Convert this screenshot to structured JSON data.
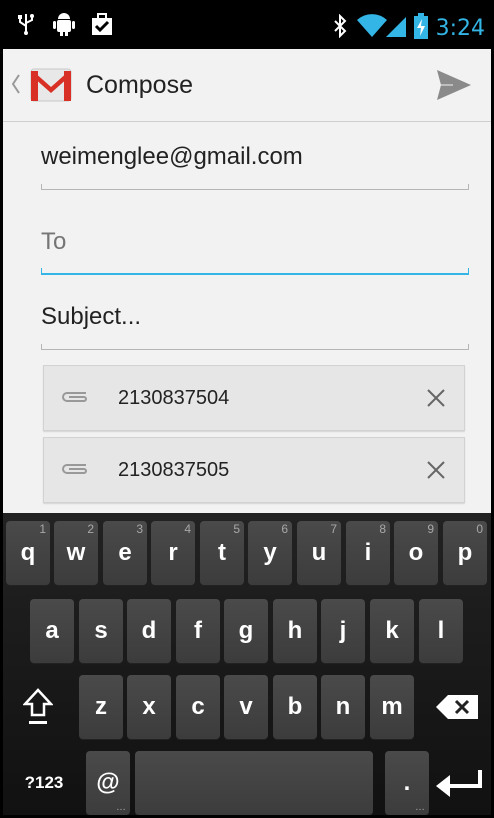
{
  "status_bar": {
    "time": "3:24",
    "icons": [
      "usb-icon",
      "android-debug-icon",
      "download-done-icon",
      "bluetooth-icon",
      "wifi-icon",
      "signal-icon",
      "battery-charging-icon"
    ]
  },
  "action_bar": {
    "title": "Compose",
    "icons": [
      "up-caret-icon",
      "gmail-icon",
      "send-icon"
    ]
  },
  "compose": {
    "from": "weimenglee@gmail.com",
    "to_placeholder": "To",
    "subject": "Subject..."
  },
  "attachments": [
    {
      "name": "2130837504"
    },
    {
      "name": "2130837505"
    }
  ],
  "keyboard": {
    "row1": [
      {
        "label": "q",
        "hint": "1"
      },
      {
        "label": "w",
        "hint": "2"
      },
      {
        "label": "e",
        "hint": "3"
      },
      {
        "label": "r",
        "hint": "4"
      },
      {
        "label": "t",
        "hint": "5"
      },
      {
        "label": "y",
        "hint": "6"
      },
      {
        "label": "u",
        "hint": "7"
      },
      {
        "label": "i",
        "hint": "8"
      },
      {
        "label": "o",
        "hint": "9"
      },
      {
        "label": "p",
        "hint": "0"
      }
    ],
    "row2": [
      "a",
      "s",
      "d",
      "f",
      "g",
      "h",
      "j",
      "k",
      "l"
    ],
    "row3": [
      "z",
      "x",
      "c",
      "v",
      "b",
      "n",
      "m"
    ],
    "symbols_label": "?123",
    "at_label": "@",
    "period_label": ".",
    "key_icons": [
      "shift-icon",
      "backspace-icon",
      "enter-icon"
    ]
  },
  "colors": {
    "accent": "#33b5e5",
    "background": "#f2f2f2",
    "keyboard": "#1a1a1a",
    "key": "#444444"
  }
}
